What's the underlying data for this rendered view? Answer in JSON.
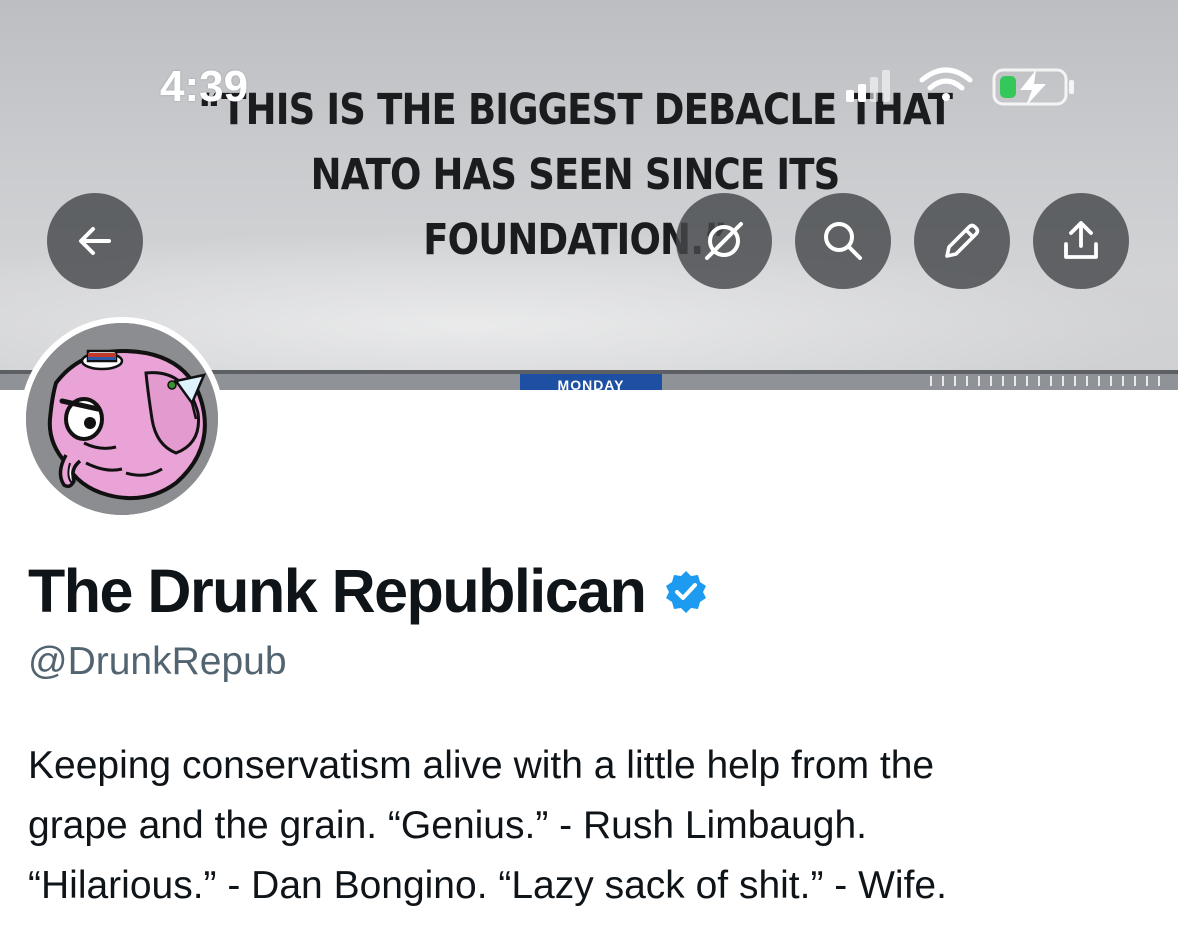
{
  "status_bar": {
    "time": "4:39"
  },
  "banner": {
    "quote_lines": [
      "“THIS IS THE BIGGEST DEBACLE THAT",
      "NATO HAS SEEN SINCE ITS",
      "FOUNDATION.”"
    ],
    "lower_third_tag": "MONDAY"
  },
  "header_buttons": {
    "back": "back-arrow-icon",
    "mute": "bell-slash-icon",
    "search": "search-icon",
    "edit": "pencil-icon",
    "share": "share-icon"
  },
  "profile": {
    "display_name": "The Drunk Republican",
    "handle": "@DrunkRepub",
    "verified": true,
    "verified_color": "#1d9bf0",
    "bio_lines": [
      "Keeping conservatism alive with a little help from the",
      "grape and the grain. “Genius.” - Rush Limbaugh.",
      "“Hilarious.” - Dan Bongino. “Lazy sack of shit.” - Wife."
    ]
  },
  "colors": {
    "text_primary": "#0f1419",
    "text_secondary": "#536471",
    "avatar_elephant": "#e9a3d6",
    "button_bg": "#46484c"
  }
}
